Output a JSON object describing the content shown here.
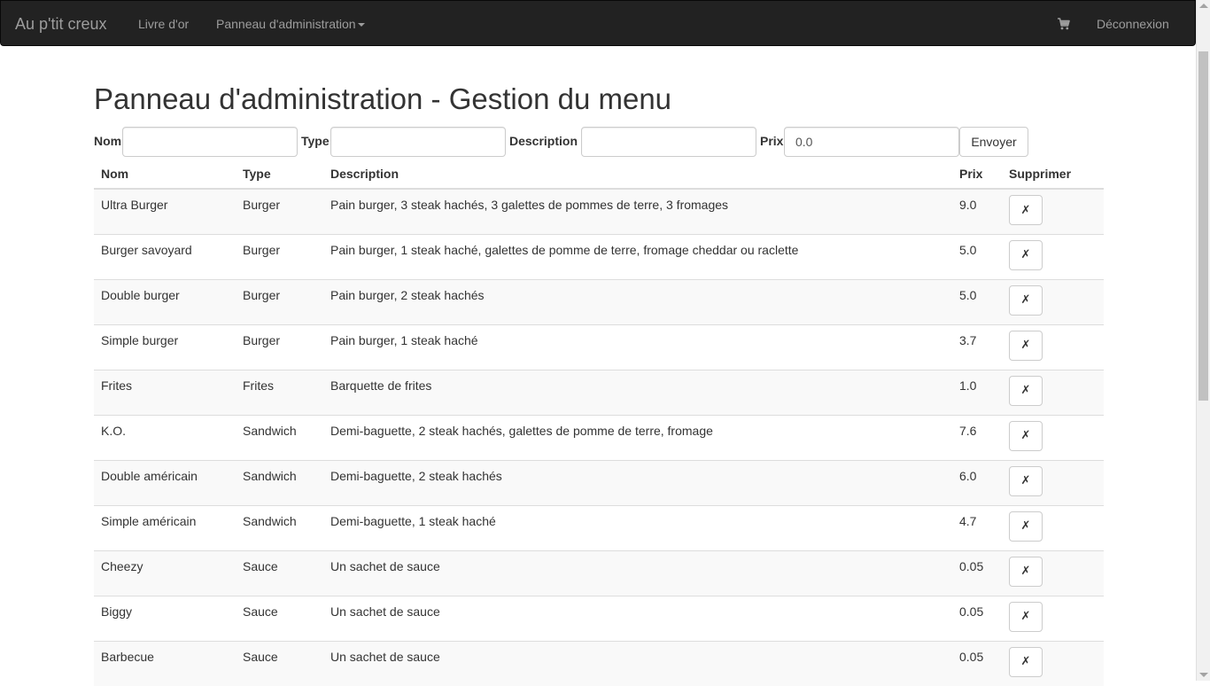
{
  "navbar": {
    "brand": "Au p'tit creux",
    "links": {
      "guestbook": "Livre d'or",
      "admin": "Panneau d'administration",
      "logout": "Déconnexion"
    },
    "cart_icon": "shopping-cart-icon"
  },
  "page": {
    "title": "Panneau d'administration - Gestion du menu"
  },
  "form": {
    "labels": {
      "name": "Nom",
      "type": "Type",
      "description": "Description",
      "price": "Prix"
    },
    "values": {
      "name": "",
      "type": "",
      "description": "",
      "price": "0.0"
    },
    "submit_label": "Envoyer"
  },
  "table": {
    "headers": {
      "name": "Nom",
      "type": "Type",
      "description": "Description",
      "price": "Prix",
      "delete": "Supprimer"
    },
    "delete_symbol": "✗",
    "rows": [
      {
        "name": "Ultra Burger",
        "type": "Burger",
        "description": "Pain burger, 3 steak hachés, 3 galettes de pommes de terre, 3 fromages",
        "price": "9.0"
      },
      {
        "name": "Burger savoyard",
        "type": "Burger",
        "description": "Pain burger, 1 steak haché, galettes de pomme de terre, fromage cheddar ou raclette",
        "price": "5.0"
      },
      {
        "name": "Double burger",
        "type": "Burger",
        "description": "Pain burger, 2 steak hachés",
        "price": "5.0"
      },
      {
        "name": "Simple burger",
        "type": "Burger",
        "description": "Pain burger, 1 steak haché",
        "price": "3.7"
      },
      {
        "name": "Frites",
        "type": "Frites",
        "description": "Barquette de frites",
        "price": "1.0"
      },
      {
        "name": "K.O.",
        "type": "Sandwich",
        "description": "Demi-baguette, 2 steak hachés, galettes de pomme de terre, fromage",
        "price": "7.6"
      },
      {
        "name": "Double américain",
        "type": "Sandwich",
        "description": "Demi-baguette, 2 steak hachés",
        "price": "6.0"
      },
      {
        "name": "Simple américain",
        "type": "Sandwich",
        "description": "Demi-baguette, 1 steak haché",
        "price": "4.7"
      },
      {
        "name": "Cheezy",
        "type": "Sauce",
        "description": "Un sachet de sauce",
        "price": "0.05"
      },
      {
        "name": "Biggy",
        "type": "Sauce",
        "description": "Un sachet de sauce",
        "price": "0.05"
      },
      {
        "name": "Barbecue",
        "type": "Sauce",
        "description": "Un sachet de sauce",
        "price": "0.05"
      }
    ]
  }
}
